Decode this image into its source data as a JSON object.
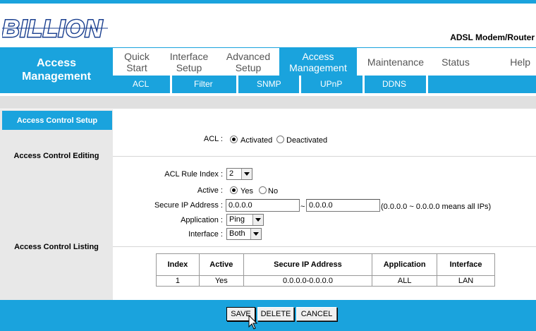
{
  "brand": {
    "logo_text": "BILLION",
    "product": "ADSL Modem/Router"
  },
  "nav": {
    "section_line1": "Access",
    "section_line2": "Management",
    "tabs": [
      {
        "line1": "Quick",
        "line2": "Start"
      },
      {
        "line1": "Interface",
        "line2": "Setup"
      },
      {
        "line1": "Advanced",
        "line2": "Setup"
      },
      {
        "line1": "Access",
        "line2": "Management"
      },
      {
        "line1": "Maintenance",
        "line2": ""
      },
      {
        "line1": "Status",
        "line2": ""
      },
      {
        "line1": "Help",
        "line2": ""
      }
    ],
    "subtabs": [
      "ACL",
      "Filter",
      "SNMP",
      "UPnP",
      "DDNS"
    ]
  },
  "sidebar": {
    "header": "Access Control Setup",
    "editing": "Access Control Editing",
    "listing": "Access Control Listing"
  },
  "acl": {
    "label": "ACL :",
    "activated": "Activated",
    "deactivated": "Deactivated",
    "selected": "Activated"
  },
  "form": {
    "rule_index_label": "ACL Rule Index :",
    "rule_index_value": "2",
    "active_label": "Active :",
    "active_yes": "Yes",
    "active_no": "No",
    "active_selected": "Yes",
    "secure_ip_label": "Secure IP Address :",
    "ip_start": "0.0.0.0",
    "ip_sep": "~",
    "ip_end": "0.0.0.0",
    "ip_hint": "(0.0.0.0 ~ 0.0.0.0 means all IPs)",
    "application_label": "Application :",
    "application_value": "Ping",
    "interface_label": "Interface :",
    "interface_value": "Both"
  },
  "table": {
    "headers": [
      "Index",
      "Active",
      "Secure IP Address",
      "Application",
      "Interface"
    ],
    "rows": [
      [
        "1",
        "Yes",
        "0.0.0.0-0.0.0.0",
        "ALL",
        "LAN"
      ]
    ]
  },
  "buttons": {
    "save": "SAVE",
    "delete": "DELETE",
    "cancel": "CANCEL"
  }
}
